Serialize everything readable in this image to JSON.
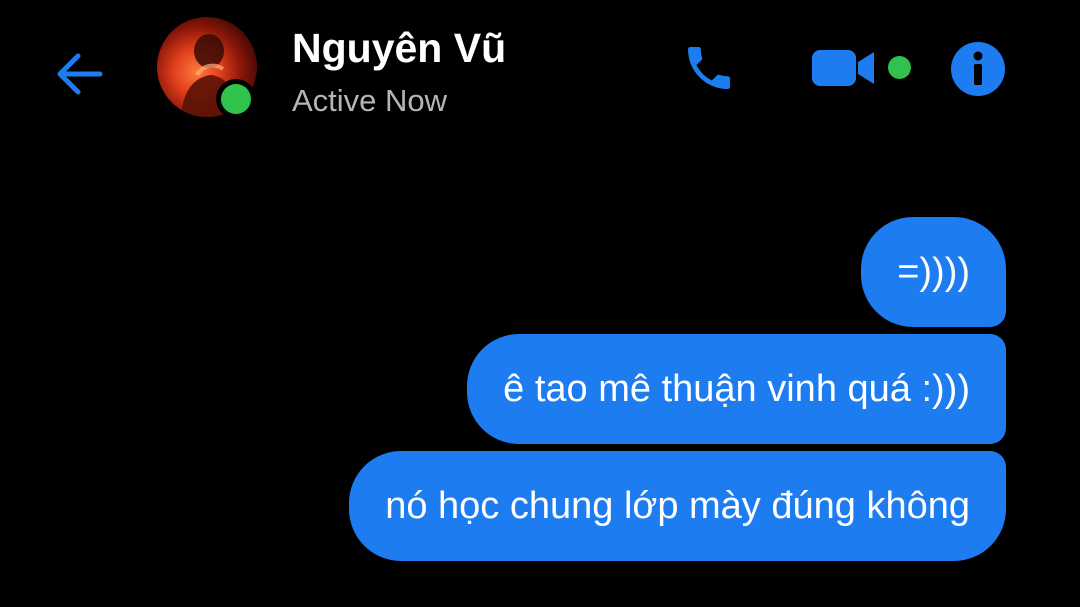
{
  "header": {
    "back_icon": "arrow-left-icon",
    "contact_name": "Nguyên Vũ",
    "status": "Active Now",
    "avatar_icon": "contact-avatar",
    "call_icon": "phone-icon",
    "video_icon": "video-camera-icon",
    "info_icon": "info-icon"
  },
  "messages": [
    {
      "text": "=))))",
      "sender": "me"
    },
    {
      "text": "ê tao mê thuận vinh quá :)))",
      "sender": "me"
    },
    {
      "text": "nó học chung lớp mày đúng không",
      "sender": "me"
    }
  ],
  "colors": {
    "background": "#000000",
    "accent": "#1c7cf0",
    "bubble": "#1c7cf0",
    "presence": "#31c24d",
    "status_text": "#b5b5b5"
  }
}
